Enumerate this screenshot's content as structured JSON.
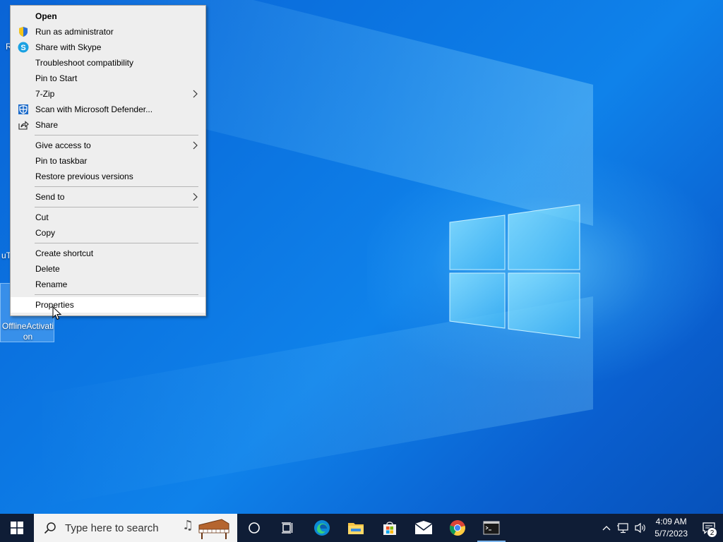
{
  "desktop": {
    "fragments": [
      "R",
      "uT"
    ],
    "selected_icon_label": "OfflineActivation"
  },
  "context_menu": {
    "groups": [
      [
        {
          "label": "Open",
          "bold": true,
          "icon": ""
        },
        {
          "label": "Run as administrator",
          "icon": "uac-shield-icon"
        },
        {
          "label": "Share with Skype",
          "icon": "skype-icon"
        },
        {
          "label": "Troubleshoot compatibility",
          "icon": ""
        },
        {
          "label": "Pin to Start",
          "icon": ""
        },
        {
          "label": "7-Zip",
          "icon": "",
          "submenu": true
        },
        {
          "label": "Scan with Microsoft Defender...",
          "icon": "defender-icon"
        },
        {
          "label": "Share",
          "icon": "share-icon"
        }
      ],
      [
        {
          "label": "Give access to",
          "icon": "",
          "submenu": true
        },
        {
          "label": "Pin to taskbar",
          "icon": ""
        },
        {
          "label": "Restore previous versions",
          "icon": ""
        }
      ],
      [
        {
          "label": "Send to",
          "icon": "",
          "submenu": true
        }
      ],
      [
        {
          "label": "Cut",
          "icon": ""
        },
        {
          "label": "Copy",
          "icon": ""
        }
      ],
      [
        {
          "label": "Create shortcut",
          "icon": ""
        },
        {
          "label": "Delete",
          "icon": ""
        },
        {
          "label": "Rename",
          "icon": ""
        }
      ],
      [
        {
          "label": "Properties",
          "icon": "",
          "hover": true
        }
      ]
    ]
  },
  "taskbar": {
    "search_placeholder": "Type here to search",
    "apps": [
      "cortana-icon",
      "task-view-icon",
      "edge-icon",
      "file-explorer-icon",
      "microsoft-store-icon",
      "mail-icon",
      "chrome-icon",
      "command-prompt-icon"
    ],
    "clock": {
      "time": "4:09 AM",
      "date": "5/7/2023"
    },
    "notification_count": "2"
  }
}
